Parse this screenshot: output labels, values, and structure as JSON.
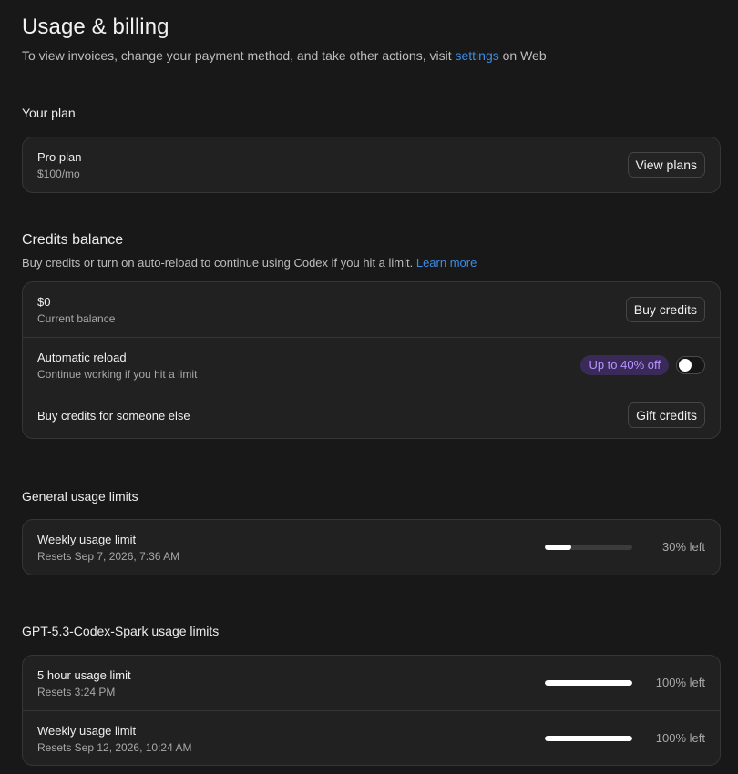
{
  "header": {
    "title": "Usage & billing",
    "subtitle_before": "To view invoices, change your payment method, and take other actions, visit ",
    "subtitle_link": "settings",
    "subtitle_after": " on Web"
  },
  "plan": {
    "section_title": "Your plan",
    "name": "Pro plan",
    "price": "$100/mo",
    "button": "View plans"
  },
  "credits": {
    "section_title": "Credits balance",
    "description": "Buy credits or turn on auto-reload to continue using Codex if you hit a limit. ",
    "learn_more": "Learn more",
    "balance": {
      "amount": "$0",
      "label": "Current balance",
      "button": "Buy credits"
    },
    "reload": {
      "title": "Automatic reload",
      "subtitle": "Continue working if you hit a limit",
      "badge": "Up to 40% off",
      "enabled": false
    },
    "gift": {
      "title": "Buy credits for someone else",
      "button": "Gift credits"
    }
  },
  "general_limits": {
    "section_title": "General usage limits",
    "items": [
      {
        "title": "Weekly usage limit",
        "reset": "Resets Sep 7, 2026, 7:36 AM",
        "percent_left": 30,
        "label": "30% left"
      }
    ]
  },
  "spark_limits": {
    "section_title": "GPT-5.3-Codex-Spark usage limits",
    "items": [
      {
        "title": "5 hour usage limit",
        "reset": "Resets 3:24 PM",
        "percent_left": 100,
        "label": "100% left"
      },
      {
        "title": "Weekly usage limit",
        "reset": "Resets Sep 12, 2026, 10:24 AM",
        "percent_left": 100,
        "label": "100% left"
      }
    ]
  },
  "colors": {
    "background": "#181818",
    "card": "#212121",
    "link": "#3d8ce6",
    "badge_bg": "#3a2a59",
    "badge_text": "#b793ff"
  }
}
